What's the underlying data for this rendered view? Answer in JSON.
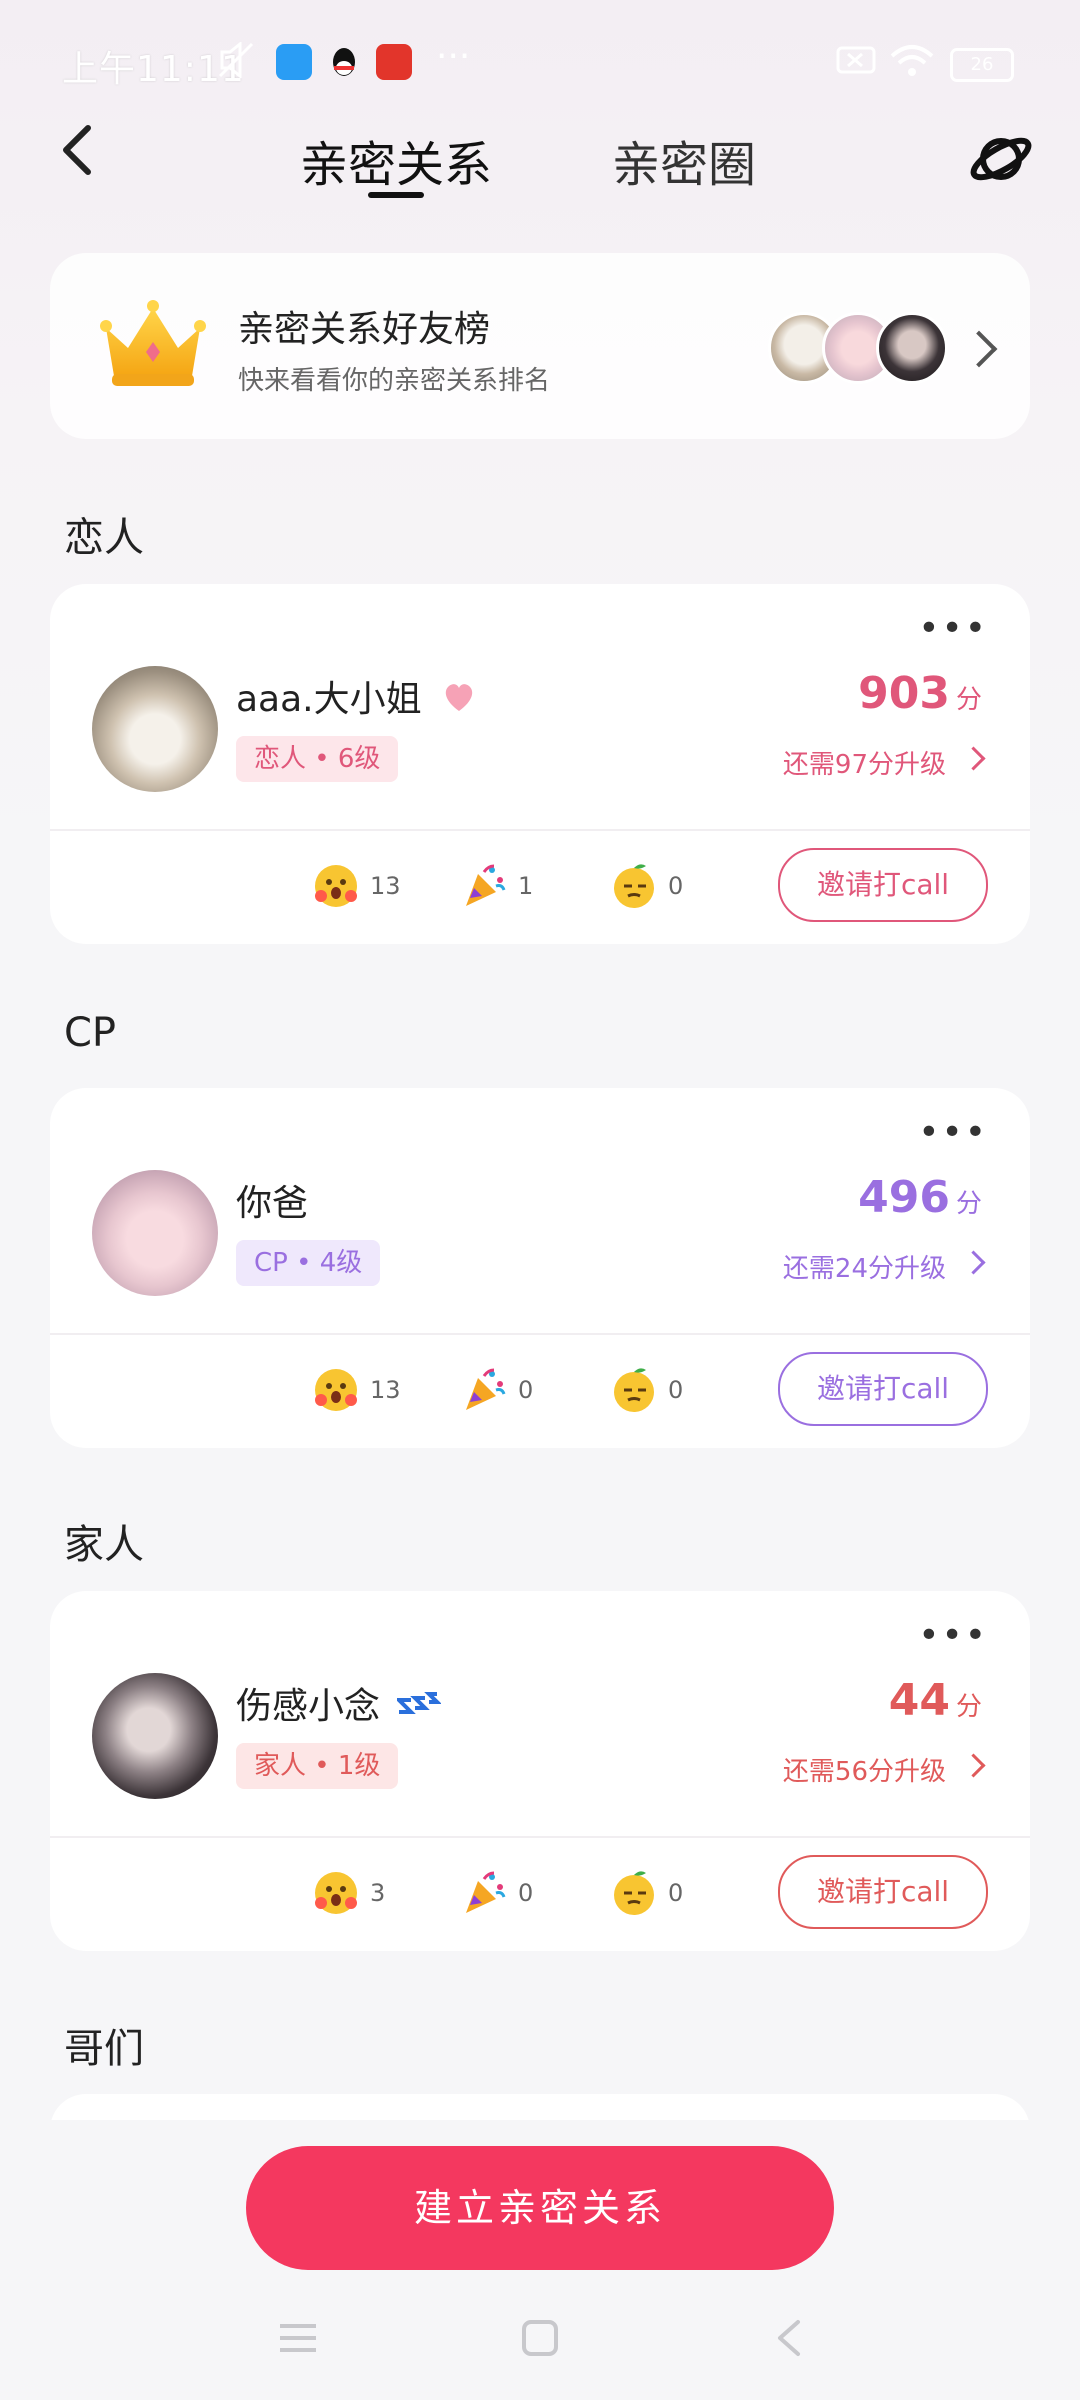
{
  "status_bar": {
    "time": "上午11:11",
    "more": "···",
    "battery": "26",
    "accent": "#ffffff"
  },
  "nav": {
    "tabs": [
      {
        "label": "亲密关系",
        "active": true
      },
      {
        "label": "亲密圈",
        "active": false
      }
    ],
    "back_icon": "chevron-left-icon",
    "planet_icon": "planet-icon"
  },
  "leaderboard": {
    "title": "亲密关系好友榜",
    "subtitle": "快来看看你的亲密关系排名"
  },
  "sections": [
    {
      "heading": "恋人",
      "accent": "#e0577a",
      "name": "aaa.大小姐",
      "badge": "恋人 • 6级",
      "badge_bg": "#fde6ea",
      "score": "903",
      "score_unit": "分",
      "upgrade": "还需97分升级",
      "stats": [
        "13",
        "1",
        "0"
      ],
      "call": "邀请打call"
    },
    {
      "heading": "CP",
      "accent": "#9a6fe0",
      "name": "你爸",
      "badge": "CP • 4级",
      "badge_bg": "#efe8fc",
      "score": "496",
      "score_unit": "分",
      "upgrade": "还需24分升级",
      "stats": [
        "13",
        "0",
        "0"
      ],
      "call": "邀请打call"
    },
    {
      "heading": "家人",
      "accent": "#e05a5a",
      "name": "伤感小念",
      "badge": "家人 • 1级",
      "badge_bg": "#fde6e6",
      "score": "44",
      "score_unit": "分",
      "upgrade": "还需56分升级",
      "stats": [
        "3",
        "0",
        "0"
      ],
      "call": "邀请打call"
    }
  ],
  "section4_heading": "哥们",
  "create_button": "建立亲密关系",
  "system_nav": [
    "menu-icon",
    "home-icon",
    "back-icon"
  ]
}
